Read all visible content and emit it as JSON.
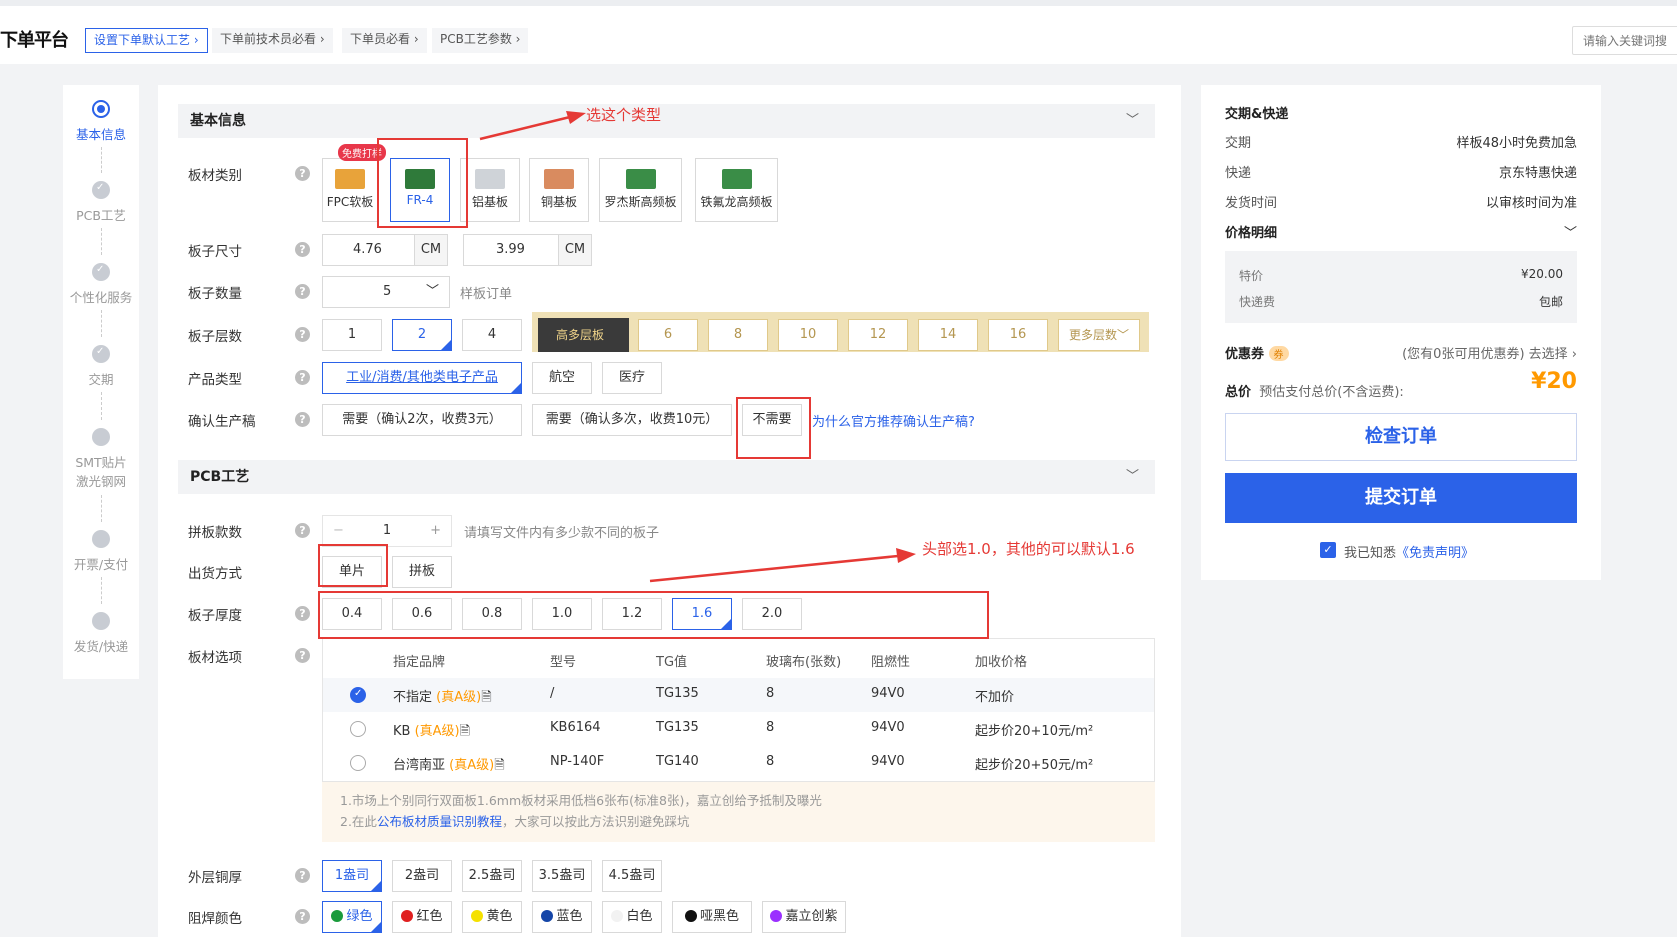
{
  "header": {
    "brand": "下单平台",
    "crumbs": [
      "设置下单默认工艺",
      "下单前技术员必看",
      "下单员必看",
      "PCB工艺参数"
    ],
    "search_placeholder": "请输入关键词搜"
  },
  "steps": [
    {
      "label": "基本信息",
      "active": true
    },
    {
      "label": "PCB工艺",
      "active": false
    },
    {
      "label": "个性化服务",
      "active": false
    },
    {
      "label": "交期",
      "active": false
    },
    {
      "label": "SMT贴片\n激光钢网",
      "active": false
    },
    {
      "label": "开票/支付",
      "active": false
    },
    {
      "label": "发货/快递",
      "active": false
    }
  ],
  "basic": {
    "title": "基本信息",
    "chevron": "﹀",
    "help": "?",
    "material_label": "板材类别",
    "materials": [
      "FPC软板",
      "FR-4",
      "铝基板",
      "铜基板",
      "罗杰斯高频板",
      "铁氟龙高频板"
    ],
    "free_badge": "免费打样",
    "size_label": "板子尺寸",
    "size_w": "4.76",
    "size_h": "3.99",
    "unit": "CM",
    "qty_label": "板子数量",
    "qty_value": "5",
    "qty_hint": "样板订单",
    "layers_label": "板子层数",
    "layers_basic": [
      "1",
      "2",
      "4"
    ],
    "high_layer_badge": "高多层板",
    "layers_high": [
      "6",
      "8",
      "10",
      "12",
      "14",
      "16"
    ],
    "more_layers": "更多层数﹀",
    "product_label": "产品类型",
    "products": [
      "工业/消费/其他类电子产品",
      "航空",
      "医疗"
    ],
    "confirm_label": "确认生产稿",
    "confirm_opts": [
      "需要（确认2次，收费3元）",
      "需要（确认多次，收费10元）",
      "不需要"
    ],
    "confirm_link": "为什么官方推荐确认生产稿?"
  },
  "pcb": {
    "title": "PCB工艺",
    "panel_label": "拼板款数",
    "panel_minus": "−",
    "panel_value": "1",
    "panel_plus": "+",
    "panel_hint": "请填写文件内有多少款不同的板子",
    "ship_label": "出货方式",
    "ship_opts": [
      "单片",
      "拼板"
    ],
    "thick_label": "板子厚度",
    "thick_opts": [
      "0.4",
      "0.6",
      "0.8",
      "1.0",
      "1.2",
      "1.6",
      "2.0"
    ],
    "mat_label": "板材选项",
    "mat_headers": [
      "指定品牌",
      "型号",
      "TG值",
      "玻璃布(张数)",
      "阻燃性",
      "加收价格"
    ],
    "mat_rows": [
      {
        "brand": "不指定",
        "grade": "(真A级)",
        "model": "/",
        "tg": "TG135",
        "glass": "8",
        "flame": "94V0",
        "price": "不加价"
      },
      {
        "brand": "KB",
        "grade": "(真A级)",
        "model": "KB6164",
        "tg": "TG135",
        "glass": "8",
        "flame": "94V0",
        "price": "起步价20+10元/m²"
      },
      {
        "brand": "台湾南亚",
        "grade": "(真A级)",
        "model": "NP-140F",
        "tg": "TG140",
        "glass": "8",
        "flame": "94V0",
        "price": "起步价20+50元/m²"
      }
    ],
    "note1": "1.市场上个别同行双面板1.6mm板材采用低档6张布(标准8张)，嘉立创给予抵制及曝光",
    "note2_pre": "2.在此",
    "note2_link": "公布板材质量识别教程",
    "note2_post": "，大家可以按此方法识别避免踩坑",
    "copper_label": "外层铜厚",
    "copper_opts": [
      "1盎司",
      "2盎司",
      "2.5盎司",
      "3.5盎司",
      "4.5盎司"
    ],
    "mask_label": "阻焊颜色",
    "mask_opts": [
      {
        "name": "绿色",
        "color": "#1a9b3c"
      },
      {
        "name": "红色",
        "color": "#e02020"
      },
      {
        "name": "黄色",
        "color": "#f5e100"
      },
      {
        "name": "蓝色",
        "color": "#1546a8"
      },
      {
        "name": "白色",
        "color": "#f2f2f2"
      },
      {
        "name": "哑黑色",
        "color": "#111111"
      },
      {
        "name": "嘉立创紫",
        "color": "#9b30ff"
      }
    ]
  },
  "annotations": {
    "type_note": "选这个类型",
    "thick_note": "头部选1.0，其他的可以默认1.6"
  },
  "side": {
    "delivery_title": "交期&快递",
    "rows": [
      {
        "k": "交期",
        "v": "样板48小时免费加急"
      },
      {
        "k": "快递",
        "v": "京东特惠快递"
      },
      {
        "k": "发货时间",
        "v": "以审核时间为准"
      }
    ],
    "price_title": "价格明细",
    "chevron": "﹀",
    "price_rows": [
      {
        "k": "特价",
        "v": "¥20.00"
      },
      {
        "k": "快递费",
        "v": "包邮"
      }
    ],
    "coupon_label": "优惠券",
    "coupon_badge": "券",
    "coupon_text": "(您有0张可用优惠券) 去选择 ›",
    "total_label": "总价",
    "total_sub": "预估支付总价(不含运费):",
    "total_value": "¥20",
    "check_btn": "检查订单",
    "submit_btn": "提交订单",
    "agree_check": "✓",
    "agree_text": "我已知悉",
    "agree_link": "《免责声明》"
  },
  "colors": {
    "accent": "#2b62e8",
    "price": "#ff9900",
    "annotation": "#e53935"
  }
}
